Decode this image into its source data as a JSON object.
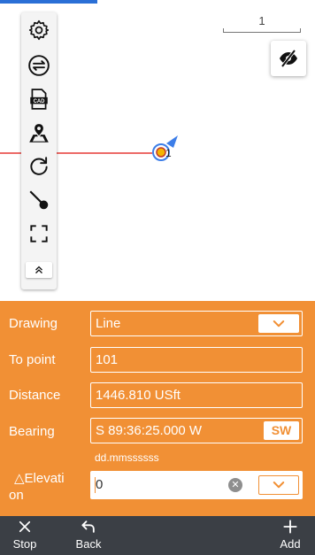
{
  "map": {
    "scale_label": "1"
  },
  "toolbar": {
    "items": [
      {
        "icon": "gear-icon"
      },
      {
        "icon": "swap-icon"
      },
      {
        "icon": "cad-file-icon"
      },
      {
        "icon": "map-pin-icon"
      },
      {
        "icon": "refresh-icon"
      },
      {
        "icon": "line-to-point-icon"
      },
      {
        "icon": "fullscreen-icon"
      },
      {
        "icon": "collapse-up-icon"
      }
    ],
    "cad_text": "CAD"
  },
  "point": {
    "label": "1"
  },
  "form": {
    "drawing_label": "Drawing",
    "drawing_value": "Line",
    "to_point_label": "To point",
    "to_point_value": "101",
    "distance_label": "Distance",
    "distance_value": "1446.810 USft",
    "bearing_label": "Bearing",
    "bearing_value": "S 89:36:25.000 W",
    "bearing_quadrant": "SW",
    "bearing_hint": "dd.mmssssss",
    "elevation_label_line1": "△Elevati",
    "elevation_label_line2": "on",
    "elevation_value": "0"
  },
  "bottombar": {
    "stop_label": "Stop",
    "back_label": "Back",
    "add_label": "Add"
  },
  "colors": {
    "accent_orange": "#f19035",
    "line_red": "#e53935",
    "bar_dark": "#3b3f45",
    "marker_blue": "#3d7ee8"
  }
}
